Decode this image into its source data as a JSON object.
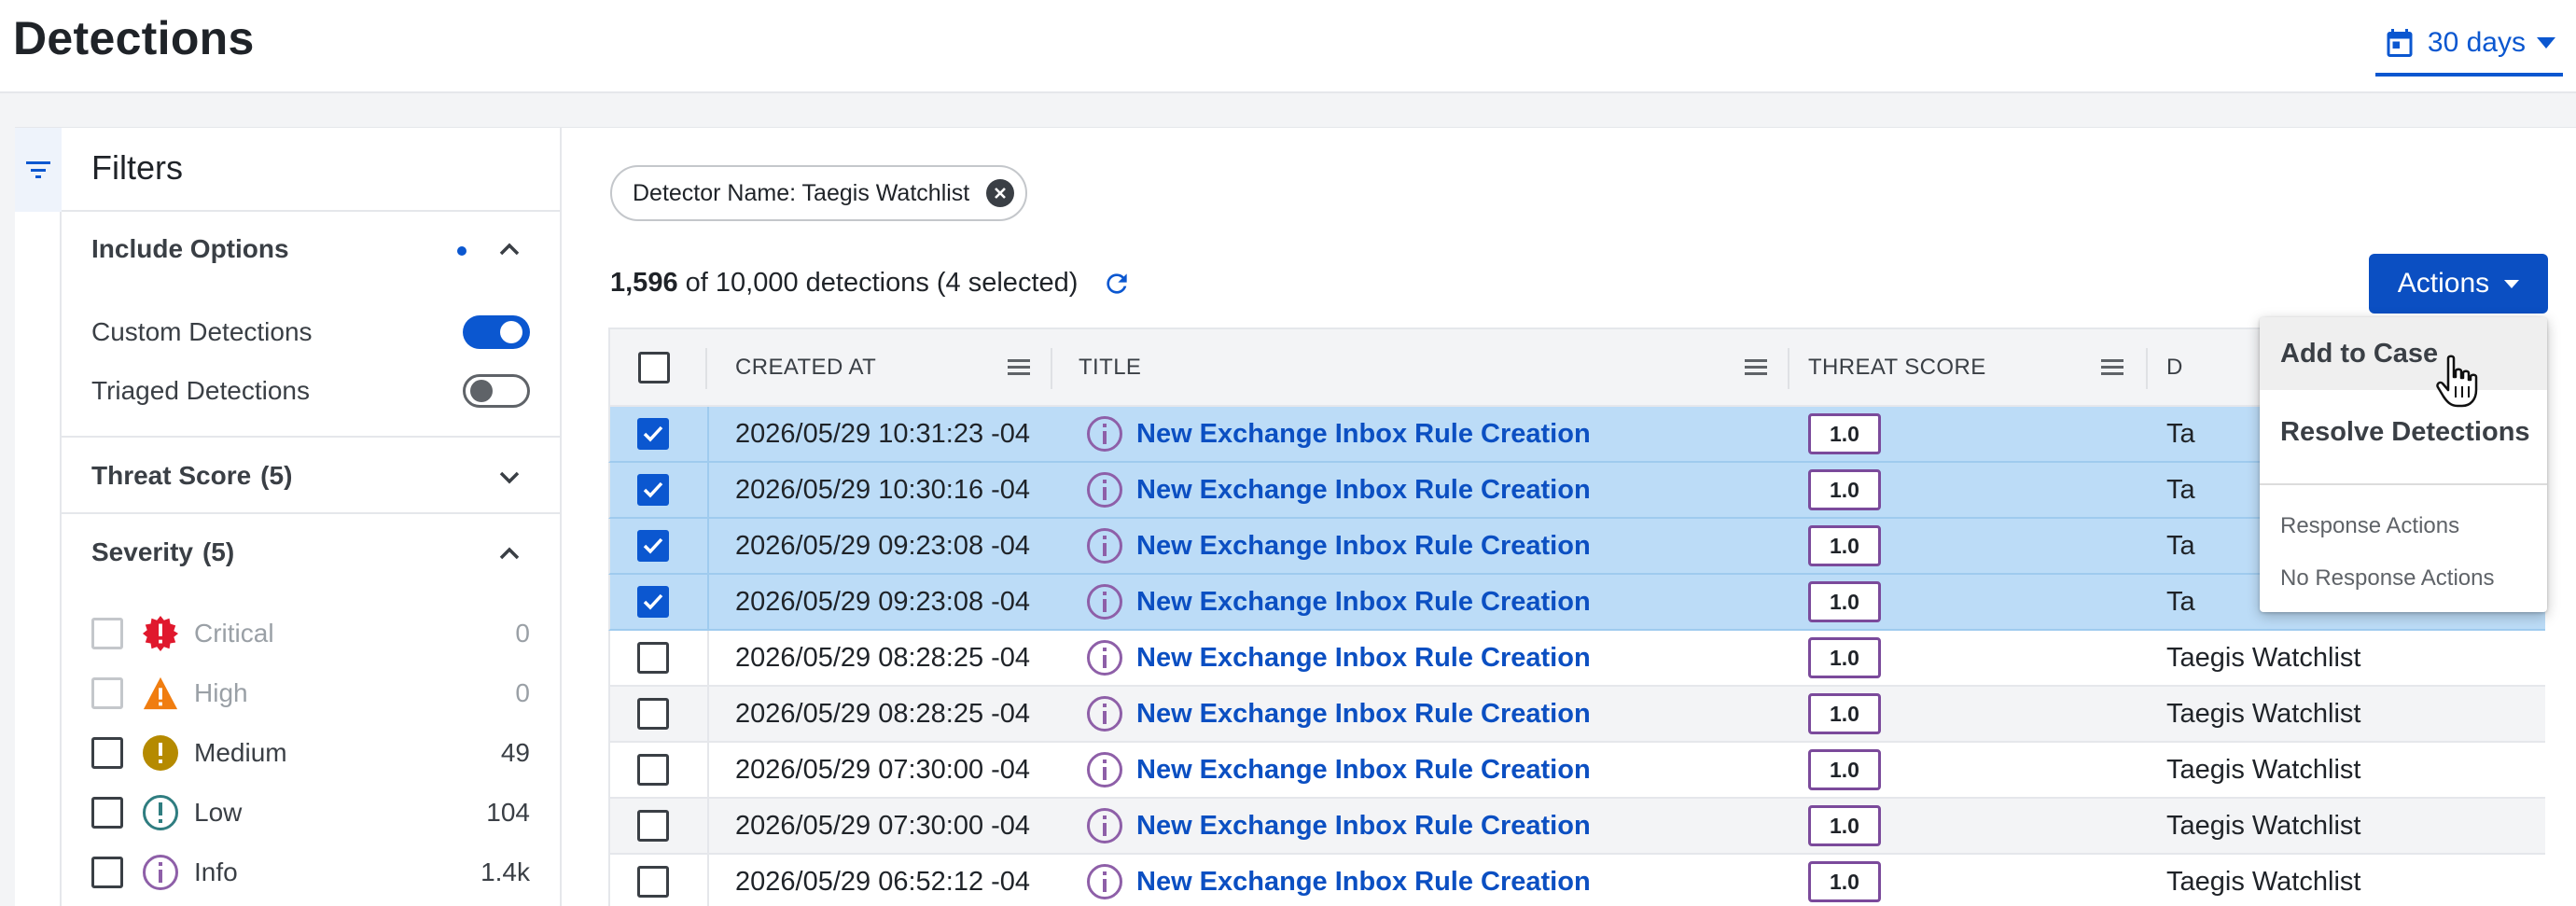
{
  "header": {
    "title": "Detections",
    "date_range": "30 days"
  },
  "filters": {
    "title": "Filters",
    "include_options": {
      "title": "Include Options",
      "options": [
        {
          "label": "Custom Detections",
          "on": true
        },
        {
          "label": "Triaged Detections",
          "on": false
        }
      ]
    },
    "threat_score": {
      "title": "Threat Score",
      "count": "(5)"
    },
    "severity": {
      "title": "Severity",
      "count": "(5)",
      "levels": [
        {
          "label": "Critical",
          "count": "0",
          "color": "#e0182d",
          "icon": "critical-icon"
        },
        {
          "label": "High",
          "count": "0",
          "color": "#f07d10",
          "icon": "high-icon"
        },
        {
          "label": "Medium",
          "count": "49",
          "color": "#b58a00",
          "icon": "medium-icon"
        },
        {
          "label": "Low",
          "count": "104",
          "color": "#2f7d80",
          "icon": "low-icon"
        },
        {
          "label": "Info",
          "count": "1.4k",
          "color": "#8e5fa8",
          "icon": "info-icon"
        }
      ]
    }
  },
  "filter_chip": {
    "label": "Detector Name: Taegis Watchlist"
  },
  "summary": {
    "shown": "1,596",
    "rest": "of 10,000 detections (4 selected)"
  },
  "actions": {
    "label": "Actions",
    "menu": {
      "primary": [
        "Add to Case",
        "Resolve Detections"
      ],
      "secondary": [
        "Response Actions",
        "No Response Actions"
      ]
    }
  },
  "table": {
    "columns": [
      "CREATED AT",
      "TITLE",
      "THREAT SCORE",
      "D"
    ],
    "rows": [
      {
        "created": "2026/05/29 10:31:23 -04",
        "title": "New Exchange Inbox Rule Creation",
        "score": "1.0",
        "detector": "Ta",
        "selected": true
      },
      {
        "created": "2026/05/29 10:30:16 -04",
        "title": "New Exchange Inbox Rule Creation",
        "score": "1.0",
        "detector": "Ta",
        "selected": true
      },
      {
        "created": "2026/05/29 09:23:08 -04",
        "title": "New Exchange Inbox Rule Creation",
        "score": "1.0",
        "detector": "Ta",
        "selected": true
      },
      {
        "created": "2026/05/29 09:23:08 -04",
        "title": "New Exchange Inbox Rule Creation",
        "score": "1.0",
        "detector": "Ta",
        "selected": true
      },
      {
        "created": "2026/05/29 08:28:25 -04",
        "title": "New Exchange Inbox Rule Creation",
        "score": "1.0",
        "detector": "Taegis Watchlist",
        "selected": false
      },
      {
        "created": "2026/05/29 08:28:25 -04",
        "title": "New Exchange Inbox Rule Creation",
        "score": "1.0",
        "detector": "Taegis Watchlist",
        "selected": false
      },
      {
        "created": "2026/05/29 07:30:00 -04",
        "title": "New Exchange Inbox Rule Creation",
        "score": "1.0",
        "detector": "Taegis Watchlist",
        "selected": false
      },
      {
        "created": "2026/05/29 07:30:00 -04",
        "title": "New Exchange Inbox Rule Creation",
        "score": "1.0",
        "detector": "Taegis Watchlist",
        "selected": false
      },
      {
        "created": "2026/05/29 06:52:12 -04",
        "title": "New Exchange Inbox Rule Creation",
        "score": "1.0",
        "detector": "Taegis Watchlist",
        "selected": false
      }
    ]
  },
  "colors": {
    "accent": "#0b57d0",
    "selected_row": "#bcdcf7",
    "score_border": "#7b4a9b"
  }
}
